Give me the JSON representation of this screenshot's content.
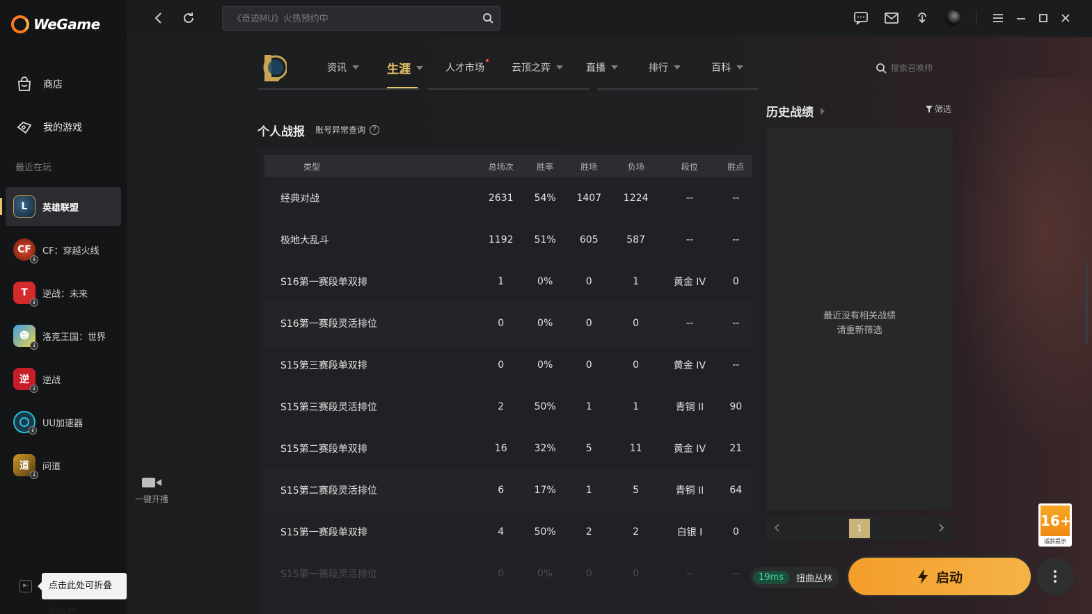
{
  "app": {
    "name": "WeGame"
  },
  "sidebar": {
    "nav": [
      {
        "label": "商店",
        "icon": "store-bag-icon"
      },
      {
        "label": "我的游戏",
        "icon": "game-controller-icon"
      }
    ],
    "recent_label": "最近在玩",
    "games": [
      {
        "label": "英雄联盟",
        "icon": "league-of-legends-icon",
        "active": true
      },
      {
        "label": "CF：穿越火线",
        "icon": "crossfire-icon"
      },
      {
        "label": "逆战：未来",
        "icon": "nizhan-future-icon"
      },
      {
        "label": "洛克王国：世界",
        "icon": "roco-kingdom-icon"
      },
      {
        "label": "逆战",
        "icon": "nizhan-icon"
      },
      {
        "label": "UU加速器",
        "icon": "uu-accelerator-icon"
      },
      {
        "label": "问道",
        "icon": "wendao-icon"
      }
    ],
    "collapse_tooltip": "点击此处可折叠侧边栏"
  },
  "topbar": {
    "search_placeholder": "《奇迹MU》火热预约中"
  },
  "game_nav": {
    "items": [
      "资讯",
      "生涯",
      "人才市场",
      "云顶之弈",
      "直播",
      "排行",
      "百科"
    ],
    "active": "生涯",
    "summoner_search_placeholder": "搜索召唤师"
  },
  "stats": {
    "title": "个人战报",
    "link": "账号异常查询",
    "columns": [
      "类型",
      "总场次",
      "胜率",
      "胜场",
      "负场",
      "段位",
      "胜点"
    ],
    "rows": [
      [
        "经典对战",
        "2631",
        "54%",
        "1407",
        "1224",
        "--",
        "--"
      ],
      [
        "极地大乱斗",
        "1192",
        "51%",
        "605",
        "587",
        "--",
        "--"
      ],
      [
        "S16第一赛段单双排",
        "1",
        "0%",
        "0",
        "1",
        "黄金 IV",
        "0"
      ],
      [
        "S16第一赛段灵活排位",
        "0",
        "0%",
        "0",
        "0",
        "--",
        "--"
      ],
      [
        "S15第三赛段单双排",
        "0",
        "0%",
        "0",
        "0",
        "黄金 IV",
        "--"
      ],
      [
        "S15第三赛段灵活排位",
        "2",
        "50%",
        "1",
        "1",
        "青铜 II",
        "90"
      ],
      [
        "S15第二赛段单双排",
        "16",
        "32%",
        "5",
        "11",
        "黄金 IV",
        "21"
      ],
      [
        "S15第二赛段灵活排位",
        "6",
        "17%",
        "1",
        "5",
        "青铜 II",
        "64"
      ],
      [
        "S15第一赛段单双排",
        "4",
        "50%",
        "2",
        "2",
        "白银 I",
        "0"
      ],
      [
        "S15第一赛段灵活排位",
        "0",
        "0%",
        "0",
        "0",
        "--",
        "--"
      ]
    ]
  },
  "history": {
    "title": "历史战绩",
    "filter": "筛选",
    "empty_line1": "最近没有相关战绩",
    "empty_line2": "请重新筛选",
    "page": "1"
  },
  "live": {
    "label": "一键开播"
  },
  "age_rating": {
    "value": "16+",
    "caption": "适龄提示"
  },
  "launch": {
    "ping": "19ms",
    "server": "扭曲丛林",
    "label": "启动"
  },
  "colors": {
    "accent": "#e8c66a",
    "launch": "#f5a733",
    "ping": "#3ed49a"
  }
}
